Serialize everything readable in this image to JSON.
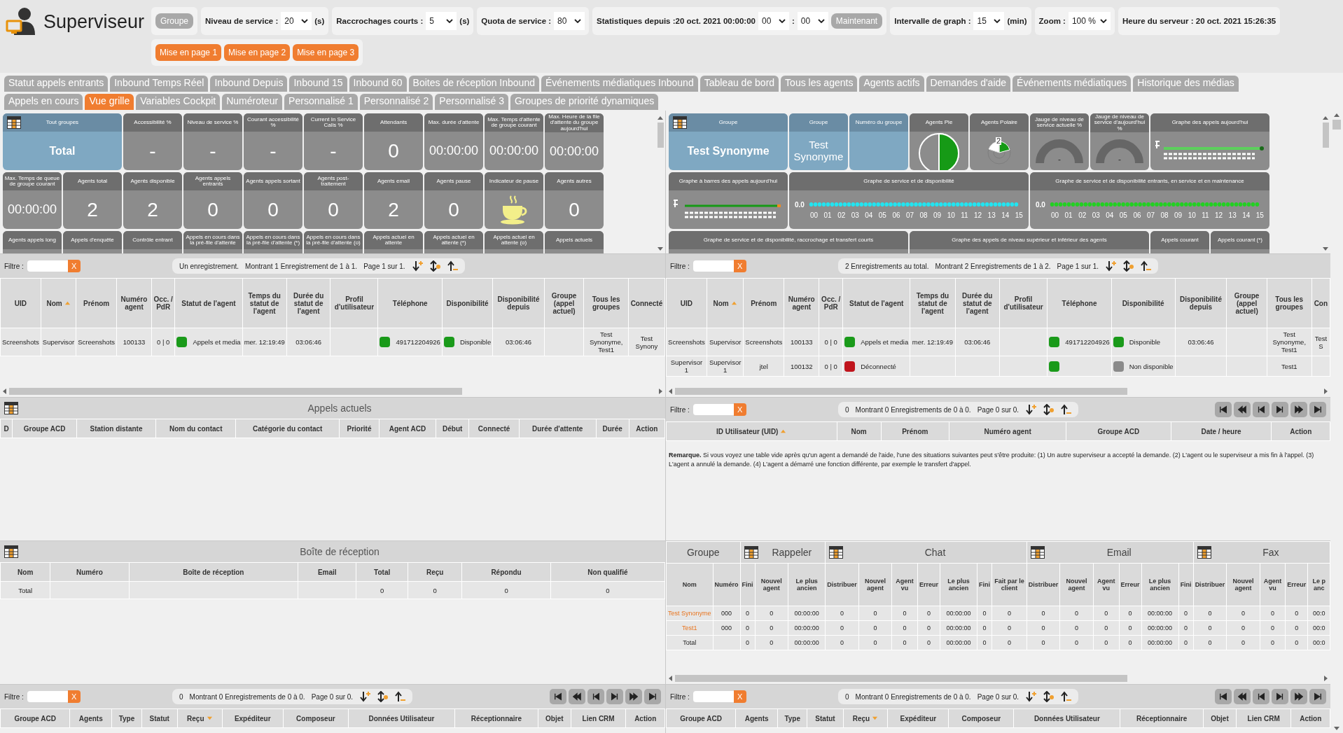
{
  "header": {
    "title": "Superviseur",
    "boxes": [
      {
        "items": [
          {
            "kind": "button",
            "text": "Groupe"
          }
        ]
      },
      {
        "items": [
          {
            "kind": "label",
            "text": "Niveau de service :"
          },
          {
            "kind": "select",
            "value": "20"
          },
          {
            "kind": "unit",
            "text": "(s)"
          }
        ]
      },
      {
        "items": [
          {
            "kind": "label",
            "text": "Raccrochages courts :"
          },
          {
            "kind": "select",
            "value": "5"
          },
          {
            "kind": "unit",
            "text": "(s)"
          }
        ]
      },
      {
        "items": [
          {
            "kind": "label",
            "text": "Quota de service :"
          },
          {
            "kind": "select",
            "value": "80"
          }
        ]
      },
      {
        "items": [
          {
            "kind": "label",
            "text": "Statistiques depuis :20 oct. 2021 00:00:00"
          },
          {
            "kind": "select",
            "value": "00"
          },
          {
            "kind": "label",
            "text": ":"
          },
          {
            "kind": "select",
            "value": "00"
          },
          {
            "kind": "button",
            "text": "Maintenant"
          }
        ]
      },
      {
        "items": [
          {
            "kind": "label",
            "text": "Intervalle de graph :"
          },
          {
            "kind": "select",
            "value": "15"
          },
          {
            "kind": "label",
            "text": "(min)"
          }
        ]
      },
      {
        "items": [
          {
            "kind": "label",
            "text": "Zoom :"
          },
          {
            "kind": "select",
            "value": "100 %"
          }
        ]
      },
      {
        "items": [
          {
            "kind": "label",
            "text": "Heure du serveur : 20 oct. 2021 15:26:35"
          }
        ]
      }
    ],
    "layouts": [
      "Mise en page 1",
      "Mise en page 2",
      "Mise en page 3"
    ]
  },
  "tab_rows": [
    {
      "tabs": [
        {
          "label": "Statut appels entrants",
          "selected": false
        },
        {
          "label": "Inbound Temps Réel",
          "selected": false
        },
        {
          "label": "Inbound Depuis",
          "selected": false
        },
        {
          "label": "Inbound 15",
          "selected": false
        },
        {
          "label": "Inbound 60",
          "selected": false
        },
        {
          "label": "Boites de réception Inbound",
          "selected": false
        },
        {
          "label": "Événements médiatiques Inbound",
          "selected": false
        },
        {
          "label": "Tableau de bord",
          "selected": false
        },
        {
          "label": "Tous les agents",
          "selected": false
        },
        {
          "label": "Agents actifs",
          "selected": false
        },
        {
          "label": "Demandes d'aide",
          "selected": false
        },
        {
          "label": "Événements médiatiques",
          "selected": false
        },
        {
          "label": "Historique des médias",
          "selected": false
        }
      ]
    },
    {
      "tabs": [
        {
          "label": "Appels en cours",
          "selected": false
        },
        {
          "label": "Vue grille",
          "selected": true
        },
        {
          "label": "Variables Cockpit",
          "selected": false
        },
        {
          "label": "Numéroteur",
          "selected": false
        },
        {
          "label": "Personnalisé 1",
          "selected": false
        },
        {
          "label": "Personnalisé 2",
          "selected": false
        },
        {
          "label": "Personnalisé 3",
          "selected": false
        },
        {
          "label": "Groupes de priorité dynamiques",
          "selected": false
        }
      ]
    }
  ],
  "left": {
    "grid": [
      {
        "kind": "summary",
        "title": "Tout groupes",
        "value": "Total"
      },
      {
        "kind": "stat",
        "title": "Accessibilité %",
        "value": "-"
      },
      {
        "kind": "stat",
        "title": "Niveau de service %",
        "value": "-"
      },
      {
        "kind": "stat",
        "title": "Courant accessibilité %",
        "value": "-"
      },
      {
        "kind": "stat",
        "title": "Current In Service Calls %",
        "value": "-"
      },
      {
        "kind": "stat",
        "title": "Attendants",
        "value": "0"
      },
      {
        "kind": "duration",
        "title": "Max. durée d'attente",
        "value": "00:00:00"
      },
      {
        "kind": "duration",
        "title": "Max. Temps d'attente de groupe courant",
        "value": "00:00:00"
      },
      {
        "kind": "duration",
        "title": "Max. Heure de la file d'attente du groupe aujourd'hui",
        "value": "00:00:00"
      },
      {
        "kind": "duration",
        "title": "Max. Temps de queue de groupe courant",
        "value": "00:00:00"
      },
      {
        "kind": "stat",
        "title": "Agents total",
        "value": "2"
      },
      {
        "kind": "stat",
        "title": "Agents disponible",
        "value": "2"
      },
      {
        "kind": "stat",
        "title": "Agents appels entrants",
        "value": "0"
      },
      {
        "kind": "stat",
        "title": "Agents appels sortant",
        "value": "0"
      },
      {
        "kind": "stat",
        "title": "Agents post-traitement",
        "value": "0"
      },
      {
        "kind": "stat",
        "title": "Agents email",
        "value": "2"
      },
      {
        "kind": "stat",
        "title": "Agents pause",
        "value": "0"
      },
      {
        "kind": "pause",
        "title": "Indicateur de pause"
      },
      {
        "kind": "stat",
        "title": "Agents autres",
        "value": "0"
      },
      {
        "kind": "label",
        "title": "Agents appels long"
      },
      {
        "kind": "label",
        "title": "Appels d'enquête"
      },
      {
        "kind": "label",
        "title": "Contrôle entrant"
      },
      {
        "kind": "label",
        "title": "Appels en cours dans la pré-file d'attente"
      },
      {
        "kind": "label",
        "title": "Appels en cours dans la pré-file d'attente (*)"
      },
      {
        "kind": "label",
        "title": "Appels en cours dans la pré-file d'attente (o)"
      },
      {
        "kind": "label",
        "title": "Appels actuel en attente"
      },
      {
        "kind": "label",
        "title": "Appels actuel en attente (*)"
      },
      {
        "kind": "label",
        "title": "Appels actuel en attente (o)"
      },
      {
        "kind": "label",
        "title": "Appels actuels"
      }
    ],
    "agents": {
      "filter": {
        "label": "Filtre :",
        "clear": "X"
      },
      "pager": {
        "texts": [
          "Un enregistrement.",
          "Montrant 1 Enregistrement de 1 à 1.",
          "Page 1 sur 1."
        ],
        "navigation": false
      },
      "columns": [
        "UID",
        {
          "label": "Nom",
          "sort_ascending": true
        },
        "Prénom",
        "Numéro agent",
        "Occ. / PdR",
        "Statut de l'agent",
        "Temps du statut de l'agent",
        "Durée du statut de l'agent",
        "Profil d'utilisateur",
        "Téléphone",
        "Disponibilité",
        "Disponibilité depuis",
        "Groupe (appel actuel)",
        "Tous les groupes",
        "Connecté"
      ],
      "rows": [
        [
          "Screenshots",
          "Supervisor",
          "Screenshots",
          "100133",
          "0 | 0",
          {
            "text": "Appels et media",
            "color": "#1a9a1a"
          },
          "mer. 12:19:49",
          "03:06:46",
          null,
          {
            "text": "491712204926",
            "color": "#1a9a1a"
          },
          {
            "text": "Disponible",
            "color": "#1a9a1a"
          },
          "03:06:46",
          null,
          "Test Synonyme, Test1",
          "Test Synony"
        ]
      ]
    },
    "current_calls": {
      "title": "Appels actuels",
      "columns": [
        "D",
        "Groupe ACD",
        "Station distante",
        "Nom du contact",
        "Catégorie du contact",
        "Priorité",
        "Agent ACD",
        "Début",
        "Connecté",
        "Durée d'attente",
        "Durée",
        "Action"
      ]
    },
    "mailbox": {
      "title": "Boîte de réception",
      "columns": [
        "Nom",
        "Numéro",
        "Boîte de réception",
        "Email",
        "Total",
        "Reçu",
        "Répondu",
        "Non qualifié"
      ],
      "rows": [
        [
          "Total",
          null,
          null,
          null,
          "0",
          "0",
          "0",
          "0"
        ]
      ]
    },
    "bottom": {
      "filter": {
        "label": "Filtre :",
        "clear": "X"
      },
      "pager": {
        "texts": [
          "0",
          "Montrant 0 Enregistrements de 0 à 0.",
          "Page 0 sur 0."
        ],
        "navigation": true
      },
      "columns": [
        "Groupe ACD",
        "Agents",
        "Type",
        "Statut",
        {
          "label": "Reçu",
          "sort_ascending": false
        },
        "Expéditeur",
        "Composeur",
        "Données Utilisateur",
        "Réceptionnaire",
        "Objet",
        "Lien CRM",
        "Action"
      ]
    }
  },
  "right": {
    "grid": [
      {
        "kind": "summary",
        "title": "Groupe",
        "value": "Test Synonyme"
      },
      {
        "kind": "group",
        "title": "Groupe",
        "value": "Test Synonyme"
      },
      {
        "kind": "group",
        "title": "Numéro du groupe"
      },
      {
        "kind": "pie",
        "title": "Agents Pie"
      },
      {
        "kind": "polar",
        "title": "Agents Polaire",
        "label": "2"
      },
      {
        "kind": "gauge",
        "title": "Jauge de niveau de service actuelle %",
        "value": "-"
      },
      {
        "kind": "gauge",
        "title": "Jauge de niveau de service d'aujourd'hui %",
        "value": "-"
      },
      {
        "kind": "chart_small",
        "title": "Graphe des appels aujourd'hui"
      },
      {
        "kind": "chart_bar",
        "title": "Graphe à barres des appels aujourd'hui"
      },
      {
        "kind": "chart_large",
        "title": "Graphe de service et de disponibilité",
        "color": "#22e4f0",
        "y_label": "0.0",
        "x_labels": [
          "00",
          "01",
          "02",
          "03",
          "04",
          "05",
          "06",
          "07",
          "08",
          "09",
          "10",
          "11",
          "12",
          "13",
          "14",
          "15"
        ]
      },
      {
        "kind": "chart_large",
        "title": "Graphe de service et de disponibilité entrants, en service et en maintenance",
        "color": "#22d022",
        "y_label": "0.0",
        "x_labels": [
          "00",
          "01",
          "02",
          "03",
          "04",
          "05",
          "06",
          "07",
          "08",
          "09",
          "10",
          "11",
          "12",
          "13",
          "14",
          "15"
        ]
      },
      {
        "kind": "label_wide",
        "title": "Graphe de service et de disponibilité, raccrochage et transfert courts"
      },
      {
        "kind": "label_wide",
        "title": "Graphe des appels de niveau supérieur et inférieur des agents"
      },
      {
        "kind": "label",
        "title": "Appels courant"
      },
      {
        "kind": "label",
        "title": "Appels courant (*)"
      }
    ],
    "agents": {
      "filter": {
        "label": "Filtre :",
        "clear": "X"
      },
      "pager": {
        "texts": [
          "2 Enregistrements au total.",
          "Montrant 2 Enregistrements de 1 à 2.",
          "Page 1 sur 1."
        ],
        "navigation": false
      },
      "columns": [
        "UID",
        {
          "label": "Nom",
          "sort_ascending": true
        },
        "Prénom",
        "Numéro agent",
        "Occ. / PdR",
        "Statut de l'agent",
        "Temps du statut de l'agent",
        "Durée du statut de l'agent",
        "Profil d'utilisateur",
        "Téléphone",
        "Disponibilité",
        "Disponibilité depuis",
        "Groupe (appel actuel)",
        "Tous les groupes",
        "Con"
      ],
      "rows": [
        [
          "Screenshots",
          "Supervisor",
          "Screenshots",
          "100133",
          "0 | 0",
          {
            "text": "Appels et media",
            "color": "#1a9a1a"
          },
          "mer. 12:19:49",
          "03:06:46",
          null,
          {
            "text": "491712204926",
            "color": "#1a9a1a"
          },
          {
            "text": "Disponible",
            "color": "#1a9a1a"
          },
          "03:06:46",
          null,
          "Test Synonyme, Test1",
          "Test S"
        ],
        [
          "Supervisor 1",
          "Supervisor 1",
          "jtel",
          "100132",
          "0 | 0",
          {
            "text": "Déconnecté",
            "color": "#c0141c"
          },
          null,
          null,
          null,
          {
            "color": "#1a9a1a"
          },
          {
            "text": "Non disponible",
            "color": "#8a8a8a"
          },
          null,
          null,
          "Test1",
          null
        ]
      ]
    },
    "help_requests": {
      "filter": {
        "label": "Filtre :",
        "clear": "X"
      },
      "pager": {
        "texts": [
          "0",
          "Montrant 0 Enregistrements de 0 à 0.",
          "Page 0 sur 0."
        ],
        "navigation": true
      },
      "columns": [
        {
          "label": "ID Utilisateur (UID)",
          "sort_ascending": true
        },
        "Nom",
        "Prénom",
        "Numéro agent",
        "Groupe ACD",
        "Date / heure",
        "Action"
      ],
      "remark": "**Remarque.** Si vous voyez une table vide après qu'un agent a demandé de l'aide, l'une des situations suivantes peut s'être produite: (1) Un autre superviseur a accepté la demande. (2) L'agent ou le superviseur a mis fin à l'appel. (3) L'agent a annulé la demande. (4) L'agent a démarré une fonction différente, par exemple le transfert d'appel."
    },
    "media": {
      "groups": [
        {
          "title": "Groupe",
          "icon": false,
          "columns": [
            "Nom",
            "Numéro"
          ]
        },
        {
          "title": "Rappeler",
          "icon": true,
          "columns": [
            "Fini",
            "Nouvel agent",
            "Le plus ancien"
          ]
        },
        {
          "title": "Chat",
          "icon": true,
          "columns": [
            "Distribuer",
            "Nouvel agent",
            "Agent vu",
            "Erreur",
            "Le plus ancien",
            "Fini",
            "Fait par le client"
          ]
        },
        {
          "title": "Email",
          "icon": true,
          "columns": [
            "Distribuer",
            "Nouvel agent",
            "Agent vu",
            "Erreur",
            "Le plus ancien",
            "Fini"
          ]
        },
        {
          "title": "Fax",
          "icon": true,
          "columns": [
            "Distribuer",
            "Nouvel agent",
            "Agent vu",
            "Erreur",
            "Le p anc"
          ]
        }
      ],
      "rows": [
        {
          "link": true,
          "cells": [
            "Test Synonyme",
            "000",
            "0",
            "0",
            "00:00:00",
            "0",
            "0",
            "0",
            "0",
            "00:00:00",
            "0",
            "0",
            "0",
            "0",
            "0",
            "0",
            "00:00:00",
            "0",
            "0",
            "0",
            "0",
            "0",
            "00:0"
          ]
        },
        {
          "link": true,
          "cells": [
            "Test1",
            "000",
            "0",
            "0",
            "00:00:00",
            "0",
            "0",
            "0",
            "0",
            "00:00:00",
            "0",
            "0",
            "0",
            "0",
            "0",
            "0",
            "00:00:00",
            "0",
            "0",
            "0",
            "0",
            "0",
            "00:0"
          ]
        },
        {
          "link": false,
          "cells": [
            "Total",
            null,
            "0",
            "0",
            "00:00:00",
            "0",
            "0",
            "0",
            "0",
            "00:00:00",
            "0",
            "0",
            "0",
            "0",
            "0",
            "0",
            "00:00:00",
            "0",
            "0",
            "0",
            "0",
            "0",
            "00:0"
          ]
        }
      ]
    },
    "bottom": {
      "filter": {
        "label": "Filtre :",
        "clear": "X"
      },
      "pager": {
        "texts": [
          "0",
          "Montrant 0 Enregistrements de 0 à 0.",
          "Page 0 sur 0."
        ],
        "navigation": true
      },
      "columns": [
        "Groupe ACD",
        "Agents",
        "Type",
        "Statut",
        {
          "label": "Reçu",
          "sort_ascending": false
        },
        "Expéditeur",
        "Composeur",
        "Données Utilisateur",
        "Réceptionnaire",
        "Objet",
        "Lien CRM",
        "Action"
      ]
    }
  }
}
